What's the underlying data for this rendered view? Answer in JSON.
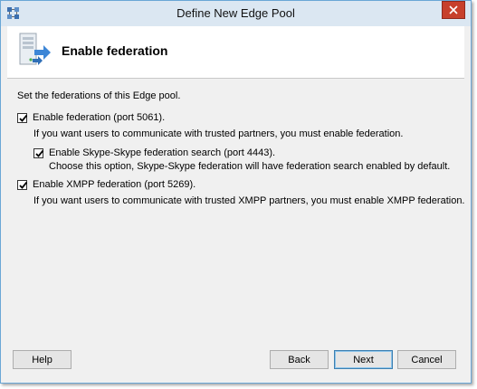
{
  "window": {
    "title": "Define New Edge Pool"
  },
  "header": {
    "title": "Enable federation",
    "icon": "server-arrow-icon"
  },
  "content": {
    "intro": "Set the federations of this Edge pool.",
    "federation": {
      "label": "Enable federation (port 5061).",
      "checked": true,
      "description": "If you want users to communicate with trusted partners, you must enable federation."
    },
    "skype": {
      "label": "Enable Skype-Skype federation search (port 4443).",
      "checked": true,
      "description": "Choose this option, Skype-Skype federation will have federation search enabled by default."
    },
    "xmpp": {
      "label": "Enable XMPP federation (port 5269).",
      "checked": true,
      "description": "If you want users to communicate with trusted XMPP partners, you must enable XMPP federation."
    }
  },
  "buttons": {
    "help": "Help",
    "back": "Back",
    "next": "Next",
    "cancel": "Cancel"
  },
  "colors": {
    "titlebar": "#dbe7f2",
    "close": "#c7402b",
    "accent": "#3c7fb1"
  }
}
